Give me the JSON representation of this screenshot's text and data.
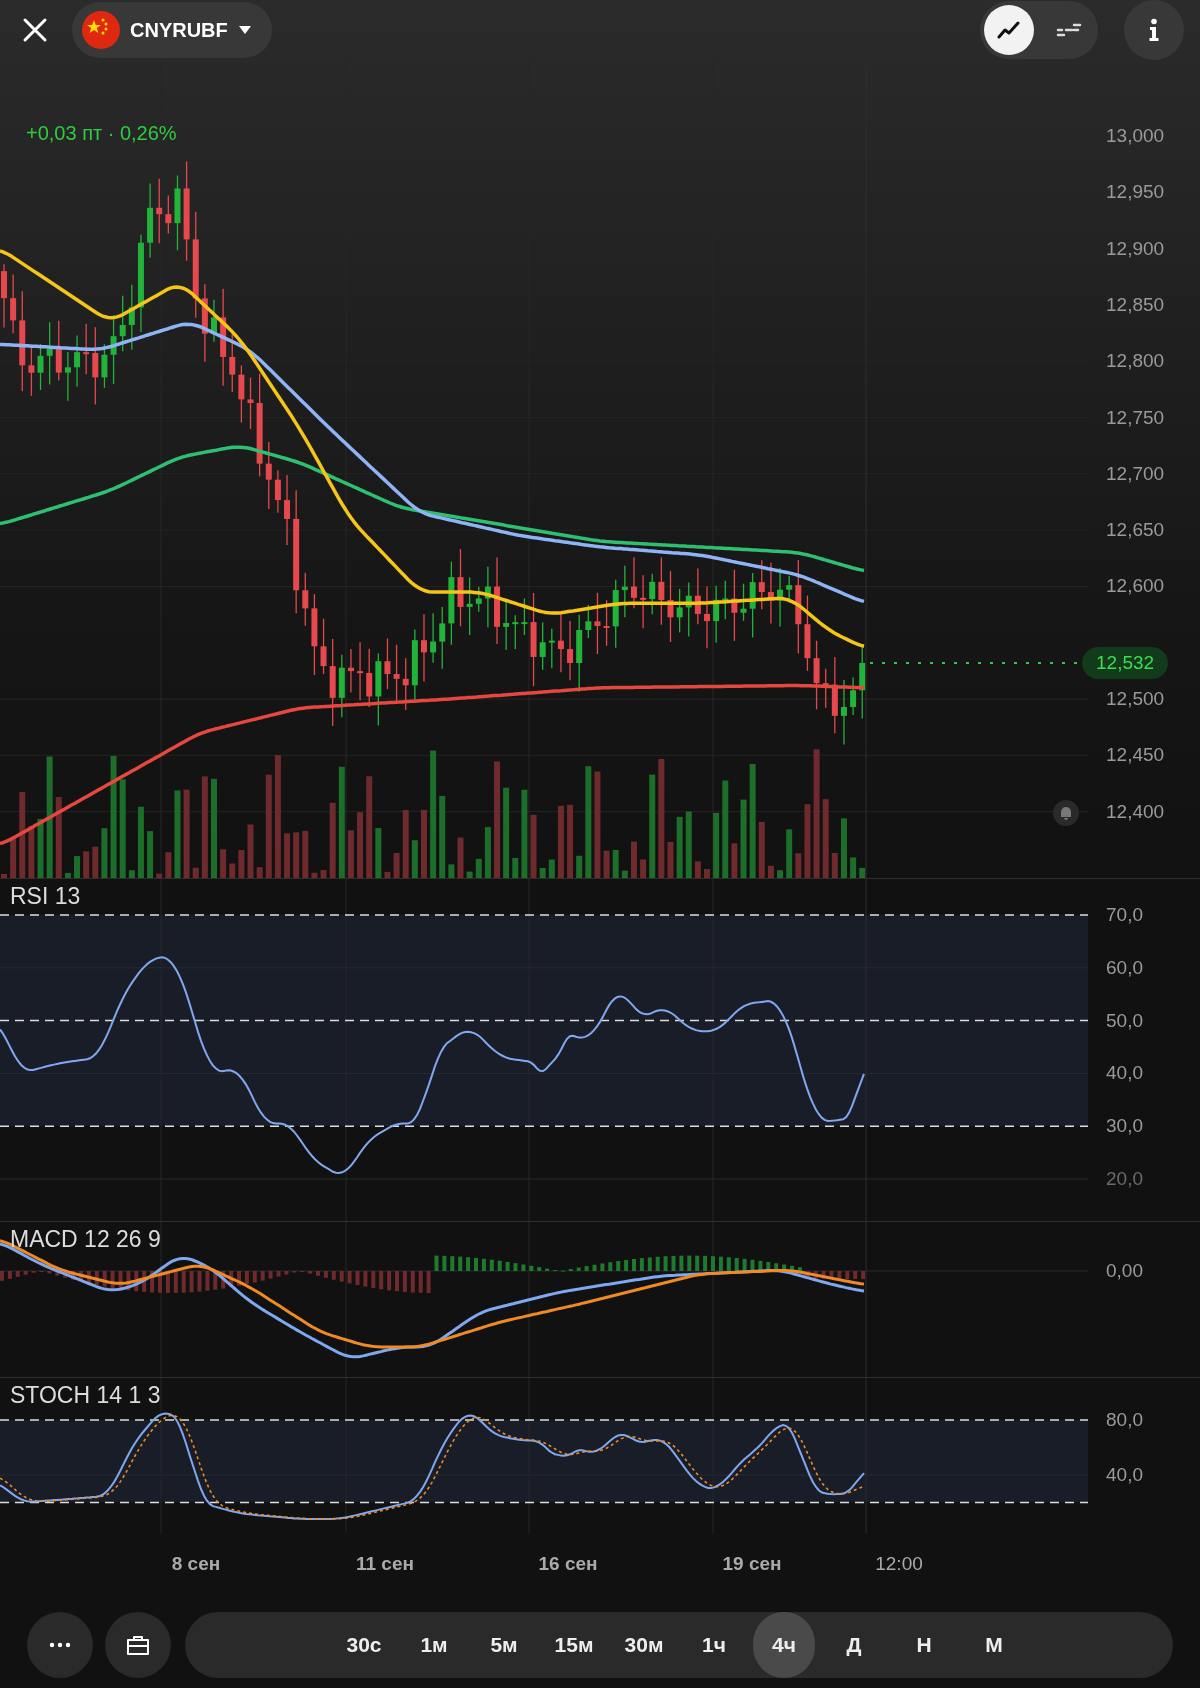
{
  "header": {
    "symbol": "CNYRUBF"
  },
  "chart_mode_buttons": [
    {
      "kind": "line",
      "selected": true
    },
    {
      "kind": "bars",
      "selected": false
    }
  ],
  "price_change": "+0,03 пт · 0,26%",
  "price_axis": [
    "13,000",
    "12,950",
    "12,900",
    "12,850",
    "12,800",
    "12,750",
    "12,700",
    "12,650",
    "12,600",
    "12,500",
    "12,450",
    "12,400"
  ],
  "current_price": "12,532",
  "indicators": [
    {
      "kind": "rsi",
      "title": "RSI 13",
      "axis": [
        "70,0",
        "60,0",
        "50,0",
        "40,0",
        "30,0",
        "20,0"
      ]
    },
    {
      "kind": "macd",
      "title": "MACD 12 26 9",
      "axis": [
        "0,00"
      ]
    },
    {
      "kind": "stoch",
      "title": "STOCH 14 1 3",
      "axis": [
        "80,0",
        "40,0"
      ]
    }
  ],
  "date_axis": [
    "8 сен",
    "11 сен",
    "16 сен",
    "19 сен",
    "12:00"
  ],
  "timeframes": [
    {
      "label": "30с",
      "selected": false
    },
    {
      "label": "1м",
      "selected": false
    },
    {
      "label": "5м",
      "selected": false
    },
    {
      "label": "15м",
      "selected": false
    },
    {
      "label": "30м",
      "selected": false
    },
    {
      "label": "1ч",
      "selected": false
    },
    {
      "label": "4ч",
      "selected": true
    },
    {
      "label": "Д",
      "selected": false
    },
    {
      "label": "Н",
      "selected": false
    },
    {
      "label": "М",
      "selected": false
    }
  ]
}
